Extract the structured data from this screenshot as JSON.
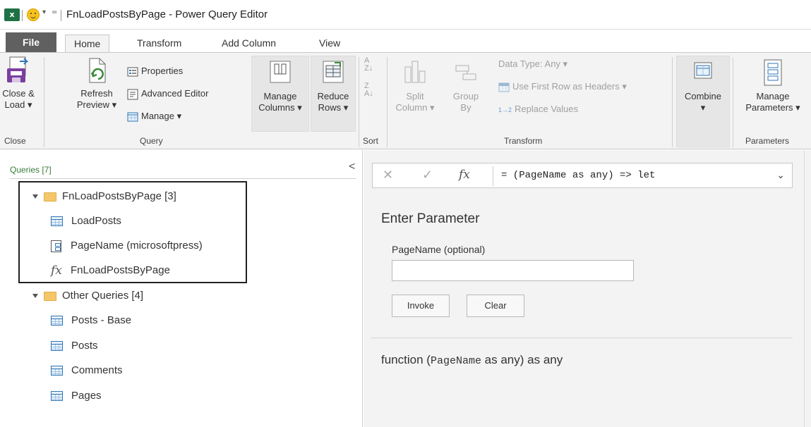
{
  "window": {
    "title": "FnLoadPostsByPage - Power Query Editor",
    "app_logo_text": "x",
    "qat_dropdown": "▾",
    "qat_customize": "="
  },
  "tabs": [
    {
      "label": "File"
    },
    {
      "label": "Home"
    },
    {
      "label": "Transform"
    },
    {
      "label": "Add Column"
    },
    {
      "label": "View"
    }
  ],
  "ribbon": {
    "close_load": {
      "line1": "Close &",
      "line2": "Load ▾"
    },
    "refresh_preview": {
      "line1": "Refresh",
      "line2": "Preview ▾"
    },
    "properties": "Properties",
    "advanced_editor": "Advanced Editor",
    "manage": "Manage ▾",
    "manage_columns": {
      "line1": "Manage",
      "line2": "Columns ▾"
    },
    "reduce_rows": {
      "line1": "Reduce",
      "line2": "Rows ▾"
    },
    "split_column": {
      "line1": "Split",
      "line2": "Column ▾"
    },
    "group_by": {
      "line1": "Group",
      "line2": "By"
    },
    "data_type": "Data Type: Any ▾",
    "use_first_row": "Use First Row as Headers ▾",
    "replace_values": "Replace Values",
    "replace_prefix": "1→2",
    "combine": {
      "line1": "Combine",
      "line2": "▾"
    },
    "manage_parameters": {
      "line1": "Manage",
      "line2": "Parameters ▾"
    },
    "group_labels": {
      "close": "Close",
      "query": "Query",
      "sort": "Sort",
      "transform": "Transform",
      "parameters": "Parameters"
    }
  },
  "queries": {
    "header": "Queries [7]",
    "collapse": "<",
    "tree": [
      {
        "kind": "folder",
        "label": "FnLoadPostsByPage [3]"
      },
      {
        "kind": "table",
        "label": "LoadPosts"
      },
      {
        "kind": "parameter",
        "label": "PageName (microsoftpress)"
      },
      {
        "kind": "function",
        "label": "FnLoadPostsByPage"
      },
      {
        "kind": "folder",
        "label": "Other Queries [4]"
      },
      {
        "kind": "table",
        "label": "Posts - Base"
      },
      {
        "kind": "table",
        "label": "Posts"
      },
      {
        "kind": "table",
        "label": "Comments"
      },
      {
        "kind": "table",
        "label": "Pages"
      }
    ]
  },
  "formula_bar": {
    "cancel": "✕",
    "commit": "✓",
    "fx": "fx",
    "text": "= (PageName as any) => let",
    "expand": "⌄"
  },
  "enter_parameter": {
    "title": "Enter Parameter",
    "field_label": "PageName (optional)",
    "field_value": "",
    "invoke": "Invoke",
    "clear": "Clear"
  },
  "function_signature": {
    "prefix": "function (",
    "param": "PageName",
    "suffix": " as any) as any"
  }
}
